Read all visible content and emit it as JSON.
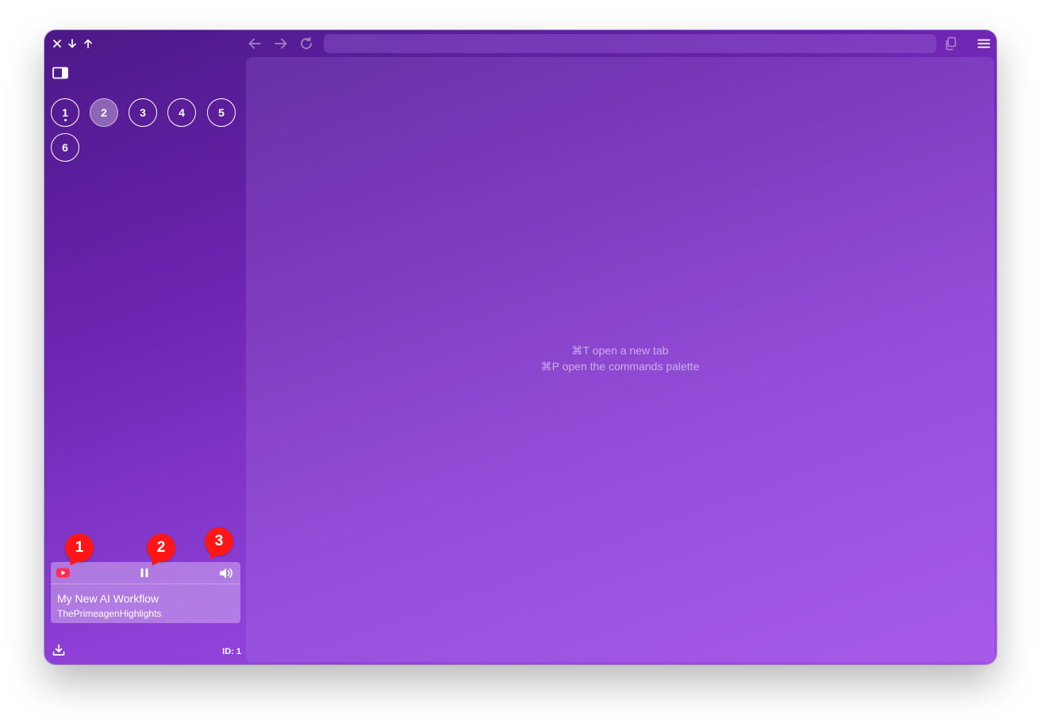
{
  "topbar": {
    "close_icon": "close-icon",
    "down_icon": "arrow-down-icon",
    "up_icon": "arrow-up-icon",
    "back_icon": "back-arrow-icon",
    "forward_icon": "forward-arrow-icon",
    "reload_icon": "reload-icon",
    "copy_icon": "copy-icon",
    "menu_icon": "menu-icon",
    "url_value": ""
  },
  "sidebar": {
    "toggle_icon": "sidebar-toggle-icon",
    "workspaces": [
      "1",
      "2",
      "3",
      "4",
      "5",
      "6"
    ],
    "active_workspace": "2",
    "media": {
      "source_icon": "youtube-icon",
      "pause_icon": "pause-icon",
      "volume_icon": "volume-icon",
      "title": "My New AI Workflow",
      "channel": "ThePrimeagenHighlights"
    },
    "download_icon": "download-icon",
    "id_label": "ID: 1"
  },
  "content": {
    "hint_new_tab": "⌘T open a new tab",
    "hint_palette": "⌘P open the commands palette"
  },
  "markers": [
    "1",
    "2",
    "3"
  ],
  "colors": {
    "gradient_start": "#4c1888",
    "gradient_end": "#a24fe8",
    "marker": "#ff1616",
    "youtube": "#ff2d55"
  }
}
